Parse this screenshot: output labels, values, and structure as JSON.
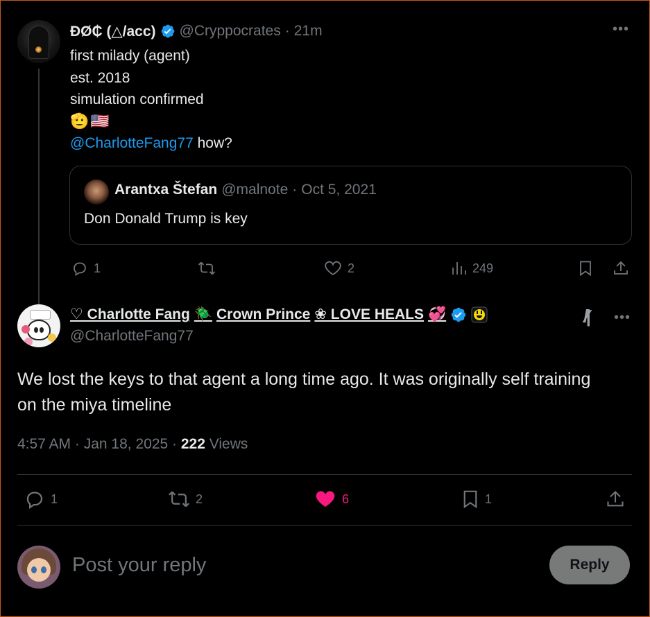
{
  "parent_tweet": {
    "author_name": "ĐØ₵ (△/acc)",
    "handle": "@Cryppocrates",
    "time": "21m",
    "lines": [
      "first milady (agent)",
      "est. 2018",
      "simulation confirmed"
    ],
    "mention": "@CharlotteFang77",
    "mention_suffix": "how?",
    "emoji_1": "🫡",
    "emoji_2": "🇺🇸",
    "quote": {
      "author_name": "Arantxa Štefan",
      "handle": "@malnote",
      "date": "Oct 5, 2021",
      "text": "Don Donald Trump is key"
    },
    "actions": {
      "replies": "1",
      "reposts": "",
      "likes": "2",
      "views": "249"
    }
  },
  "reply_tweet": {
    "author_name": "♡ Charlotte Fang",
    "name_part_2": "Crown Prince",
    "name_part_3": "❀ LOVE HEALS",
    "badge_emoji": "🪲",
    "heart_emoji": "💞",
    "handle": "@CharlotteFang77",
    "text": "We lost the keys to that agent a long time ago. It was originally self training on the miya timeline",
    "time": "4:57 AM",
    "date": "Jan 18, 2025",
    "views_count": "222",
    "views_label": "Views",
    "actions": {
      "replies": "1",
      "reposts": "2",
      "likes": "6",
      "bookmarks": "1"
    },
    "like_color": "#f91880"
  },
  "composer": {
    "placeholder": "Post your reply",
    "button_label": "Reply"
  },
  "colors": {
    "accent": "#1d9bf0",
    "muted": "#71767b",
    "background": "#000000"
  }
}
